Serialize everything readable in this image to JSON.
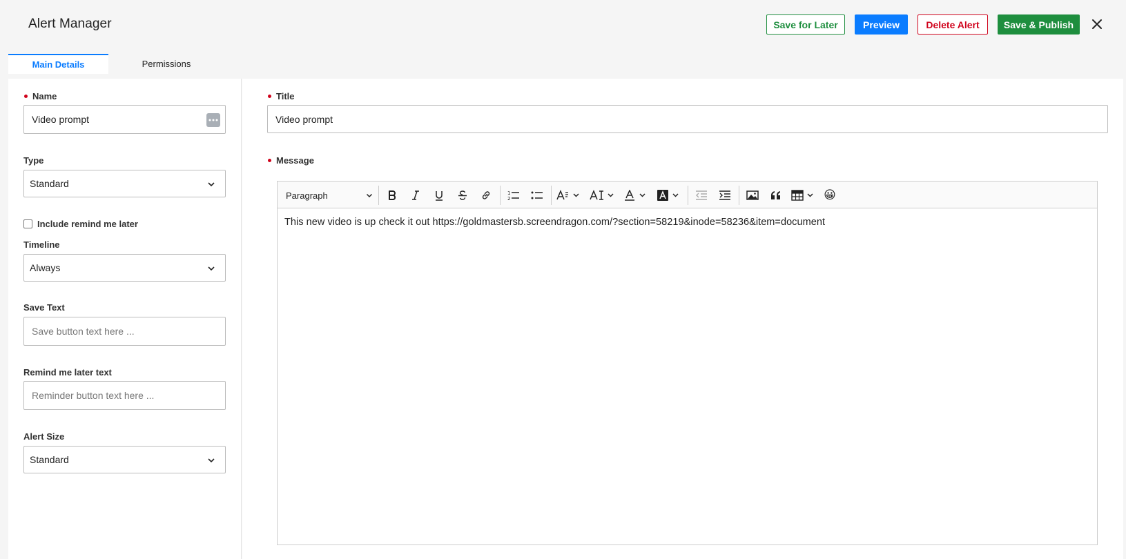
{
  "header": {
    "title": "Alert Manager",
    "save_later_label": "Save for Later",
    "preview_label": "Preview",
    "delete_label": "Delete Alert",
    "publish_label": "Save & Publish"
  },
  "tabs": [
    {
      "label": "Main Details",
      "active": true
    },
    {
      "label": "Permissions",
      "active": false
    }
  ],
  "form": {
    "name_label": "Name",
    "name_value": "Video prompt",
    "type_label": "Type",
    "type_value": "Standard",
    "remind_checkbox_label": "Include remind me later",
    "remind_checked": false,
    "timeline_label": "Timeline",
    "timeline_value": "Always",
    "save_text_label": "Save Text",
    "save_text_placeholder": "Save button text here ...",
    "remind_text_label": "Remind me later text",
    "remind_text_placeholder": "Reminder button text here ...",
    "alert_size_label": "Alert Size",
    "alert_size_value": "Standard",
    "title_label": "Title",
    "title_value": "Video prompt",
    "message_label": "Message"
  },
  "editor": {
    "block_style": "Paragraph",
    "content": "This new video is up check it out https://goldmastersb.screendragon.com/?section=58219&inode=58236&item=document",
    "emoji": "😀"
  },
  "colors": {
    "primary_blue": "#0a7cff",
    "green": "#1e8e3e",
    "red": "#d0021b",
    "background": "#f5f5f5"
  }
}
